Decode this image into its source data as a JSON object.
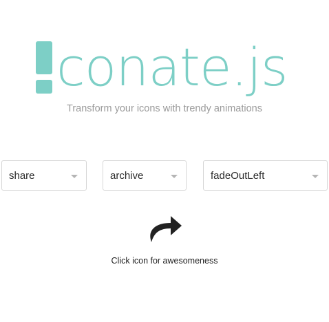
{
  "header": {
    "logo_text": "conate.js",
    "tagline": "Transform your icons with trendy animations",
    "brand_color": "#7dcfc6"
  },
  "controls": {
    "icon_select": {
      "value": "share"
    },
    "category_select": {
      "value": "archive"
    },
    "animation_select": {
      "value": "fadeOutLeft"
    }
  },
  "preview": {
    "icon": "share-arrow-icon",
    "hint": "Click icon for awesomeness"
  }
}
